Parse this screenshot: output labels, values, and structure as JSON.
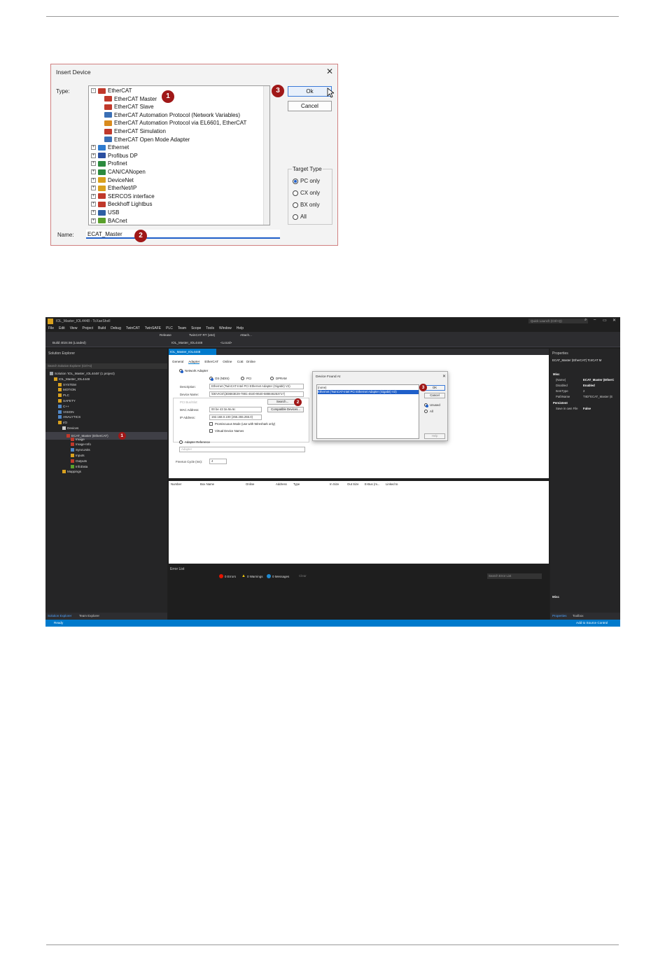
{
  "insert_device": {
    "title": "Insert Device",
    "type_label": "Type:",
    "name_label": "Name:",
    "name_value": "ECAT_Master",
    "ok": "Ok",
    "cancel": "Cancel",
    "target_type_title": "Target Type",
    "target_options": [
      "PC only",
      "CX only",
      "BX only",
      "All"
    ],
    "tree": [
      {
        "label": "EtherCAT",
        "level": 0,
        "expander": "-",
        "icon": "ethercat-icon",
        "color": "#c0392b"
      },
      {
        "label": "EtherCAT Master",
        "level": 1,
        "icon": "ethercat-master-icon",
        "color": "#c0392b"
      },
      {
        "label": "EtherCAT Slave",
        "level": 1,
        "icon": "ethercat-slave-icon",
        "color": "#c0392b"
      },
      {
        "label": "EtherCAT Automation Protocol (Network Variables)",
        "level": 1,
        "icon": "network-card-icon",
        "color": "#3a6fb5"
      },
      {
        "label": "EtherCAT Automation Protocol via EL6601, EtherCAT",
        "level": 1,
        "icon": "terminal-icon",
        "color": "#d98b1e"
      },
      {
        "label": "EtherCAT Simulation",
        "level": 1,
        "icon": "ethercat-sim-icon",
        "color": "#c0392b"
      },
      {
        "label": "EtherCAT Open Mode Adapter",
        "level": 1,
        "icon": "network-card-icon",
        "color": "#3a6fb5"
      },
      {
        "label": "Ethernet",
        "level": 0,
        "expander": "+",
        "icon": "ethernet-icon",
        "color": "#2e7bcf"
      },
      {
        "label": "Profibus DP",
        "level": 0,
        "expander": "+",
        "icon": "profibus-icon",
        "color": "#2b4fa0"
      },
      {
        "label": "Profinet",
        "level": 0,
        "expander": "+",
        "icon": "profinet-icon",
        "color": "#2b8a3e"
      },
      {
        "label": "CAN/CANopen",
        "level": 0,
        "expander": "+",
        "icon": "can-icon",
        "color": "#2b8a3e"
      },
      {
        "label": "DeviceNet",
        "level": 0,
        "expander": "+",
        "icon": "devicenet-icon",
        "color": "#d9a11e"
      },
      {
        "label": "EtherNet/IP",
        "level": 0,
        "expander": "+",
        "icon": "ethernetip-icon",
        "color": "#d9a11e"
      },
      {
        "label": "SERCOS interface",
        "level": 0,
        "expander": "+",
        "icon": "sercos-icon",
        "color": "#c0392b"
      },
      {
        "label": "Beckhoff Lightbus",
        "level": 0,
        "expander": "+",
        "icon": "lightbus-icon",
        "color": "#c0392b"
      },
      {
        "label": "USB",
        "level": 0,
        "expander": "+",
        "icon": "usb-icon",
        "color": "#2e5fa3"
      },
      {
        "label": "BACnet",
        "level": 0,
        "expander": "+",
        "icon": "bacnet-icon",
        "color": "#5aa02c"
      }
    ],
    "badges": [
      "1",
      "2",
      "3"
    ]
  },
  "ide": {
    "window_title": "IOL_Master_IOL4448 - TcXaeShell",
    "quick_launch": "Quick Launch (Ctrl+Q)",
    "menu": [
      "File",
      "Edit",
      "View",
      "Project",
      "Build",
      "Debug",
      "TwinCAT",
      "TwinSAFE",
      "PLC",
      "Team",
      "Scope",
      "Tools",
      "Window",
      "Help"
    ],
    "toolbar": {
      "config": "Release",
      "platform": "TwinCAT RT (x64)",
      "attach": "Attach...",
      "build": "Build 4024.56 (Loaded)",
      "project": "IOL_Master_IOL4448",
      "target": "<Local>"
    },
    "solution_explorer": {
      "title": "Solution Explorer",
      "search": "Search Solution Explorer (Ctrl+ü)",
      "nodes": [
        {
          "label": "Solution 'IOL_Master_IOL4448' (1 project)",
          "level": 0,
          "color": "#9aa0a6"
        },
        {
          "label": "IOL_Master_IOL4448",
          "level": 1,
          "color": "#d9a11e"
        },
        {
          "label": "SYSTEM",
          "level": 2,
          "color": "#d9a11e"
        },
        {
          "label": "MOTION",
          "level": 2,
          "color": "#d9a11e"
        },
        {
          "label": "PLC",
          "level": 2,
          "color": "#d9a11e"
        },
        {
          "label": "SAFETY",
          "level": 2,
          "color": "#d9a11e"
        },
        {
          "label": "C++",
          "level": 2,
          "color": "#4f86c6"
        },
        {
          "label": "VISION",
          "level": 2,
          "color": "#4f86c6"
        },
        {
          "label": "ANALYTICS",
          "level": 2,
          "color": "#4f86c6"
        },
        {
          "label": "I/O",
          "level": 2,
          "color": "#d9a11e"
        },
        {
          "label": "Devices",
          "level": 3,
          "color": "#c9c9c9"
        },
        {
          "label": "ECAT_Master (EtherCAT)",
          "level": 4,
          "color": "#c0392b",
          "selected": true
        },
        {
          "label": "Image",
          "level": 5,
          "color": "#c0392b"
        },
        {
          "label": "Image-Info",
          "level": 5,
          "color": "#c0392b"
        },
        {
          "label": "SyncUnits",
          "level": 5,
          "color": "#4f86c6"
        },
        {
          "label": "Inputs",
          "level": 5,
          "color": "#d9a11e"
        },
        {
          "label": "Outputs",
          "level": 5,
          "color": "#c0392b"
        },
        {
          "label": "InfoData",
          "level": 5,
          "color": "#5aa02c"
        },
        {
          "label": "Mappings",
          "level": 3,
          "color": "#d9a11e"
        }
      ],
      "bottom_tabs": [
        "Solution Explorer",
        "Team Explorer"
      ]
    },
    "doc_tab": "IOL_Master_IOL4448",
    "device_tabs": [
      "General",
      "Adapter",
      "EtherCAT",
      "Online",
      "CoE",
      "Online"
    ],
    "adapter": {
      "network_adapter": "Network Adapter",
      "os": "OS (NDIS)",
      "pci": "PCI",
      "dpram": "DPRAM",
      "description_label": "Description:",
      "description_value": "Ethernet (TwinCAT-Intel PCI Ethernet Adapter (Gigabit) V2)",
      "device_name_label": "Device Name:",
      "device_name_value": "\\DEVICE\\{3DB83E29-7881-4640-9640-588846253717}",
      "pci_label": "PCI Bus/Slot:",
      "search_button": "Search...",
      "mac_label": "MAC Address:",
      "mac_value": "00 be 43 3a 9a 6c",
      "compatible_button": "Compatible Devices...",
      "ip_label": "IP Address:",
      "ip_value": "192.168.0.100 (255.255.255.0)",
      "promiscuous": "Promiscuous Mode (use with Wireshark only)",
      "virtual_names": "Virtual Device Names",
      "adapter_reference": "Adapter Reference",
      "adapter_placeholder": "Adapter",
      "freerun_label": "Freerun Cycle (ms):",
      "freerun_value": "4"
    },
    "device_found": {
      "title": "Device Found At",
      "items": [
        "(none)",
        "Ethernet (TwinCAT-Intel PCI Ethernet Adapter (Gigabit) V2)"
      ],
      "ok": "OK",
      "cancel": "Cancel",
      "unused": "Unused",
      "all": "All",
      "help": "Help"
    },
    "grid_columns": [
      "Number",
      "Box Name",
      "Online",
      "Address",
      "Type",
      "In Size",
      "Out Size",
      "E-Bus (m...",
      "Linked to"
    ],
    "error_list": {
      "title": "Error List",
      "errors": "0 Errors",
      "warnings": "0 Warnings",
      "messages": "0 Messages",
      "clear": "Clear",
      "search": "Search Error List"
    },
    "properties": {
      "title": "Properties",
      "object": "ECAT_Master (EtherCAT) TcIrCAT M",
      "misc_header": "Misc",
      "rows": [
        {
          "name": "(Name)",
          "value": "ECAT_Master (EtherC"
        },
        {
          "name": "Disabled",
          "value": "Enabled"
        },
        {
          "name": "ItemType",
          "value": "2"
        },
        {
          "name": "PathName",
          "value": "TIID^ECAT_Master (E"
        }
      ],
      "persistent_header": "Persistent",
      "persistent_rows": [
        {
          "name": "Save in own File",
          "value": "False"
        }
      ],
      "description": "Misc",
      "bottom_tabs": [
        "Properties",
        "Toolbox"
      ]
    },
    "status": {
      "ready": "Ready",
      "source_control": "Add to Source Control"
    },
    "badges": [
      "1",
      "2",
      "3"
    ]
  }
}
